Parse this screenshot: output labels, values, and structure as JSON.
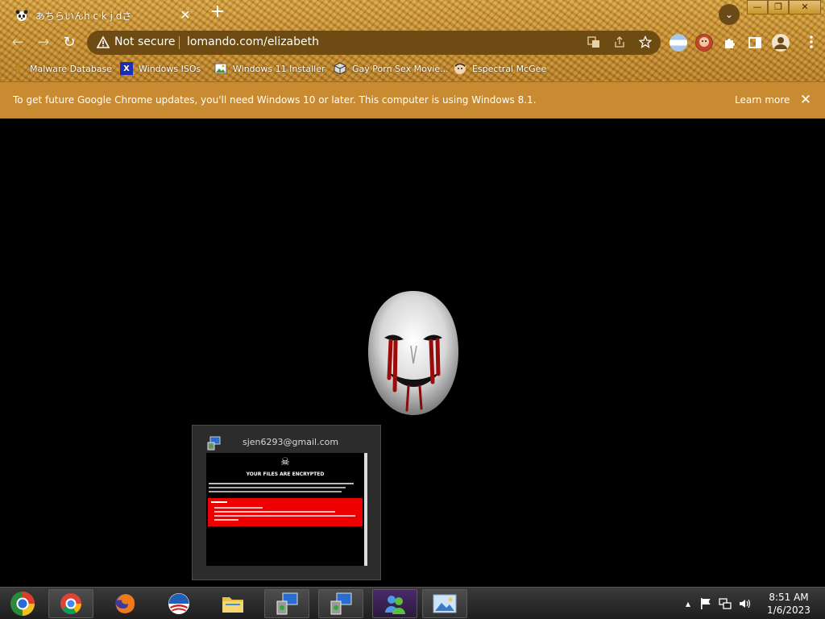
{
  "tab": {
    "title": "あちらいんh c k j dさ",
    "close": "✕"
  },
  "toolbar": {
    "new_tab": "+",
    "tab_search": "⌄",
    "back": "←",
    "forward": "→",
    "reload": "↻",
    "not_secure": "Not secure",
    "url": "lomando.com/elizabeth"
  },
  "window_controls": {
    "minimize": "—",
    "restore": "❐",
    "close": "✕"
  },
  "bookmarks": [
    {
      "label": "Malware Database",
      "icon": "sparkle-icon"
    },
    {
      "label": "Windows ISOs",
      "icon": "x-logo-icon"
    },
    {
      "label": "Windows 11 Installer",
      "icon": "image-icon"
    },
    {
      "label": "Gay Porn Sex Movie...",
      "icon": "cube-icon"
    },
    {
      "label": "Espectral McGee",
      "icon": "avatar-icon"
    }
  ],
  "infobar": {
    "message": "To get future Google Chrome updates, you'll need Windows 10 or later. This computer is using Windows 8.1.",
    "learn_more": "Learn more",
    "close": "✕"
  },
  "thumbnail": {
    "title": "sjen6293@gmail.com",
    "ransom_title": "YOUR FILES ARE ENCRYPTED",
    "colors": {
      "alert_red": "#e00000"
    }
  },
  "taskbar": {
    "time": "8:51 AM",
    "date": "1/6/2023",
    "tray_arrow": "▴"
  },
  "colors": {
    "chrome_gold": "#c98e2d",
    "infobar": "#c98b32",
    "omnibox": "#6e4b12"
  }
}
